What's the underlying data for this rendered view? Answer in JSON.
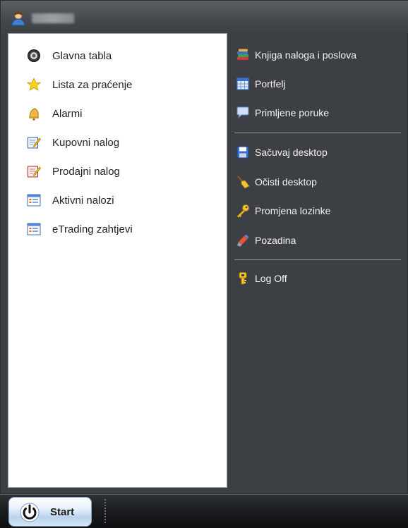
{
  "header": {
    "user_name": "user",
    "avatar_icon": "user-icon"
  },
  "left_menu": [
    {
      "label": "Glavna tabla",
      "icon": "main-board-icon"
    },
    {
      "label": "Lista za praćenje",
      "icon": "star-icon"
    },
    {
      "label": "Alarmi",
      "icon": "bell-icon"
    },
    {
      "label": "Kupovni nalog",
      "icon": "buy-order-icon"
    },
    {
      "label": "Prodajni nalog",
      "icon": "sell-order-icon"
    },
    {
      "label": "Aktivni nalozi",
      "icon": "list-window-icon"
    },
    {
      "label": "eTrading zahtjevi",
      "icon": "list-window-icon"
    }
  ],
  "right_menu": {
    "group1": [
      {
        "label": "Knjiga naloga i poslova",
        "icon": "books-icon"
      },
      {
        "label": "Portfelj",
        "icon": "table-icon"
      },
      {
        "label": "Primljene poruke",
        "icon": "speech-bubble-icon"
      }
    ],
    "group2": [
      {
        "label": "Sačuvaj desktop",
        "icon": "save-icon"
      },
      {
        "label": "Očisti desktop",
        "icon": "broom-icon"
      },
      {
        "label": "Promjena lozinke",
        "icon": "key-icon"
      },
      {
        "label": "Pozadina",
        "icon": "paint-icon"
      }
    ],
    "group3": [
      {
        "label": "Log Off",
        "icon": "logoff-key-icon"
      }
    ]
  },
  "taskbar": {
    "start_label": "Start",
    "power_icon": "power-icon"
  }
}
